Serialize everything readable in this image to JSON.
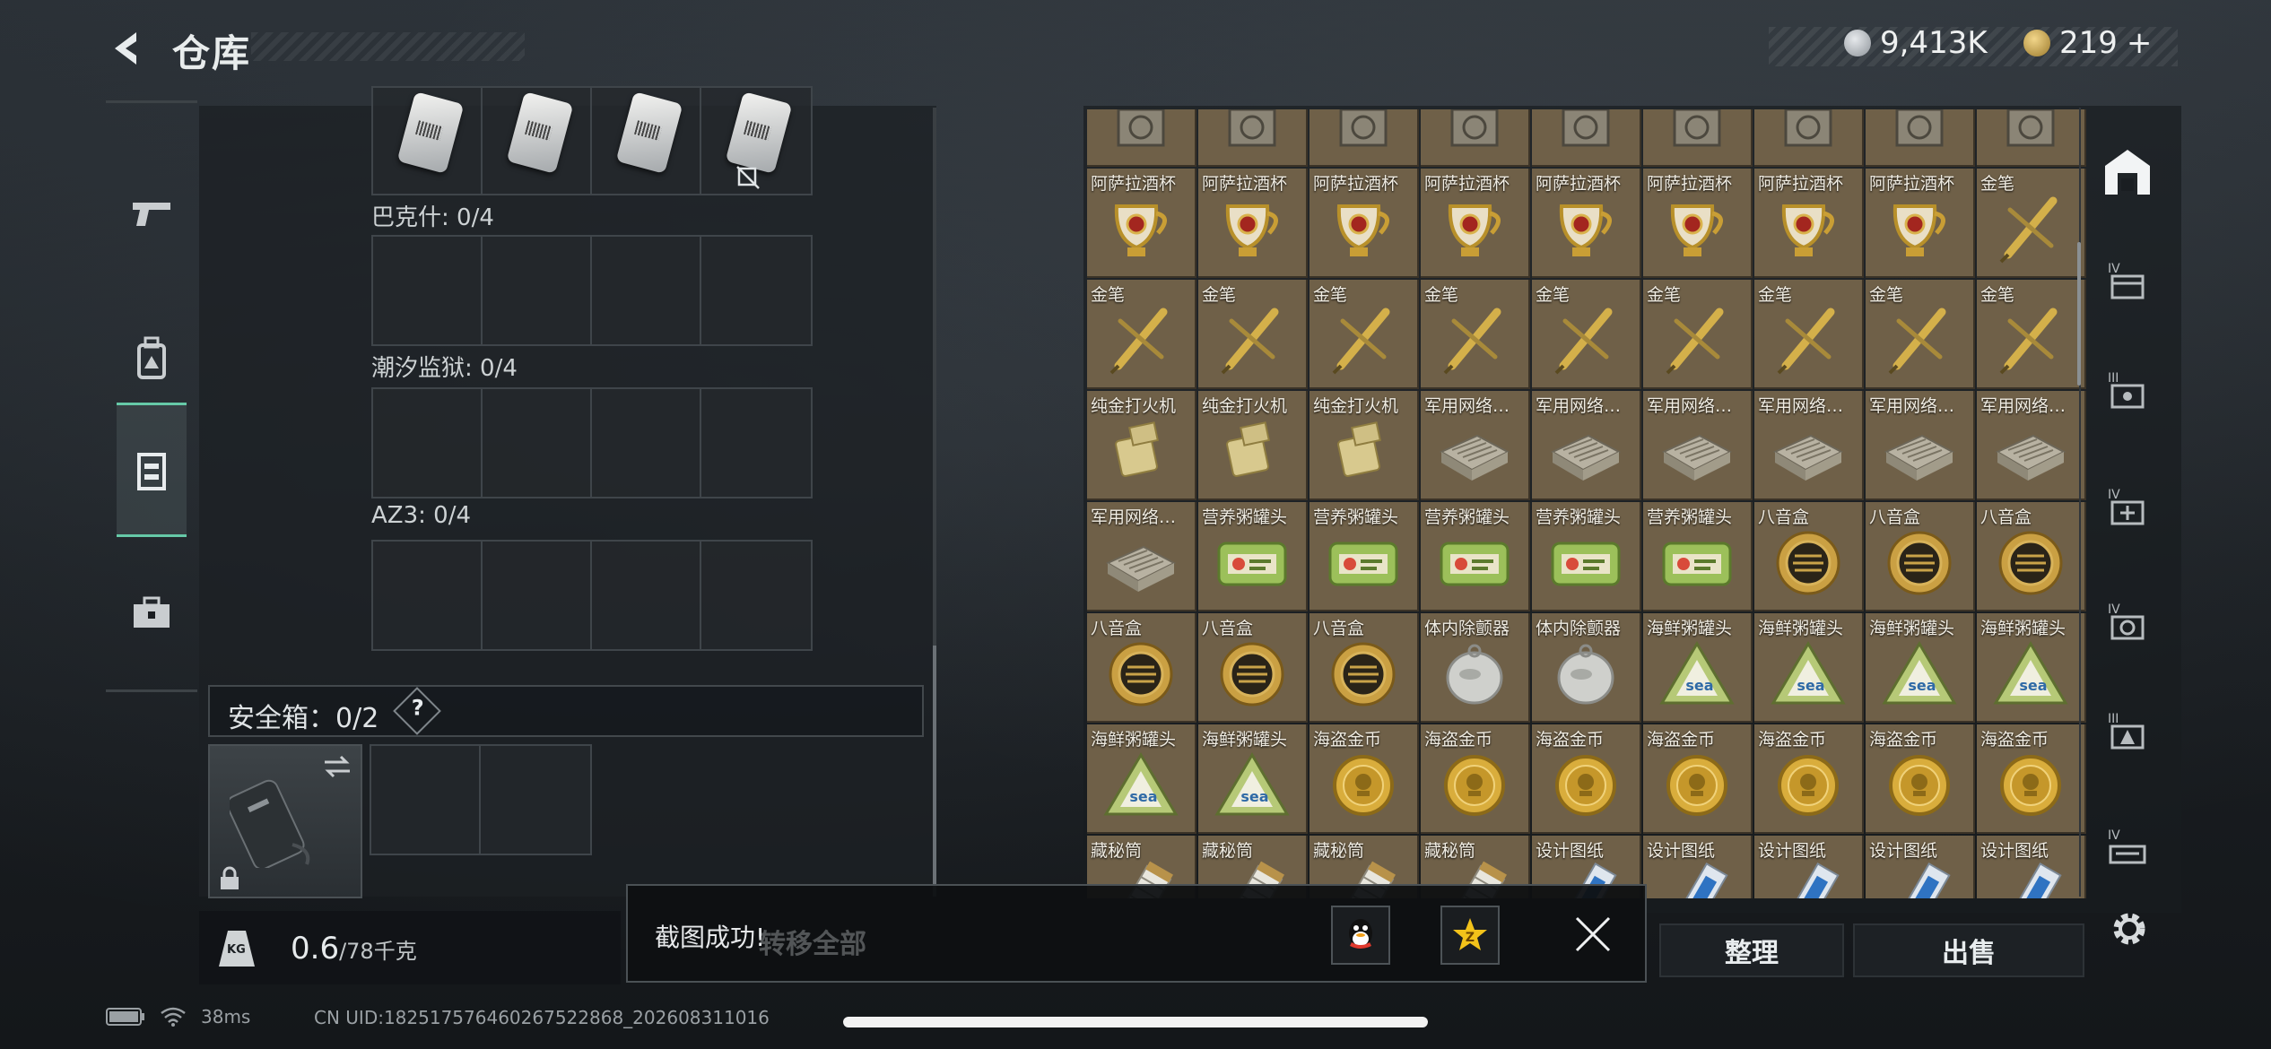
{
  "header": {
    "title": "仓库",
    "currency_silver": "9,413K",
    "currency_gold": "219",
    "currency_gold_plus": "+"
  },
  "sidebar": {
    "items": [
      {
        "icon": "pistol-icon",
        "active": false
      },
      {
        "icon": "backpack-icon",
        "active": false
      },
      {
        "icon": "chest-rig-icon",
        "active": true
      },
      {
        "icon": "toolbox-icon",
        "active": false
      }
    ]
  },
  "left_panel": {
    "sections": [
      {
        "label": "巴克什: 0/4"
      },
      {
        "label": "潮汐监狱: 0/4"
      },
      {
        "label": "AZ3: 0/4"
      }
    ],
    "safebox_label": "安全箱：0/2",
    "safebox_help": "?",
    "weight_icon": "KG",
    "weight_value": "0.6",
    "weight_max": "/78千克"
  },
  "grid": {
    "rows": [
      [
        "",
        "",
        "",
        "",
        "",
        "",
        "",
        "",
        ""
      ],
      [
        "阿萨拉酒杯",
        "阿萨拉酒杯",
        "阿萨拉酒杯",
        "阿萨拉酒杯",
        "阿萨拉酒杯",
        "阿萨拉酒杯",
        "阿萨拉酒杯",
        "阿萨拉酒杯",
        "金笔"
      ],
      [
        "金笔",
        "金笔",
        "金笔",
        "金笔",
        "金笔",
        "金笔",
        "金笔",
        "金笔",
        "金笔"
      ],
      [
        "纯金打火机",
        "纯金打火机",
        "纯金打火机",
        "军用网络…",
        "军用网络…",
        "军用网络…",
        "军用网络…",
        "军用网络…",
        "军用网络…"
      ],
      [
        "军用网络…",
        "营养粥罐头",
        "营养粥罐头",
        "营养粥罐头",
        "营养粥罐头",
        "营养粥罐头",
        "八音盒",
        "八音盒",
        "八音盒"
      ],
      [
        "八音盒",
        "八音盒",
        "八音盒",
        "体内除颤器",
        "体内除颤器",
        "海鲜粥罐头",
        "海鲜粥罐头",
        "海鲜粥罐头",
        "海鲜粥罐头"
      ],
      [
        "海鲜粥罐头",
        "海鲜粥罐头",
        "海盗金币",
        "海盗金币",
        "海盗金币",
        "海盗金币",
        "海盗金币",
        "海盗金币",
        "海盗金币"
      ],
      [
        "藏秘筒",
        "藏秘筒",
        "藏秘筒",
        "藏秘筒",
        "设计图纸",
        "设计图纸",
        "设计图纸",
        "设计图纸",
        "设计图纸"
      ]
    ]
  },
  "actions": {
    "transfer_all": "转移全部",
    "sort": "整理",
    "sell": "出售"
  },
  "toast": {
    "message": "截图成功!"
  },
  "right_rail": {
    "tiers": [
      "IV",
      "III",
      "IV",
      "IV",
      "III",
      "IV"
    ]
  },
  "status_bar": {
    "ping": "38ms",
    "uid": "CN UID:1825175764602675228​68_202608311016"
  }
}
